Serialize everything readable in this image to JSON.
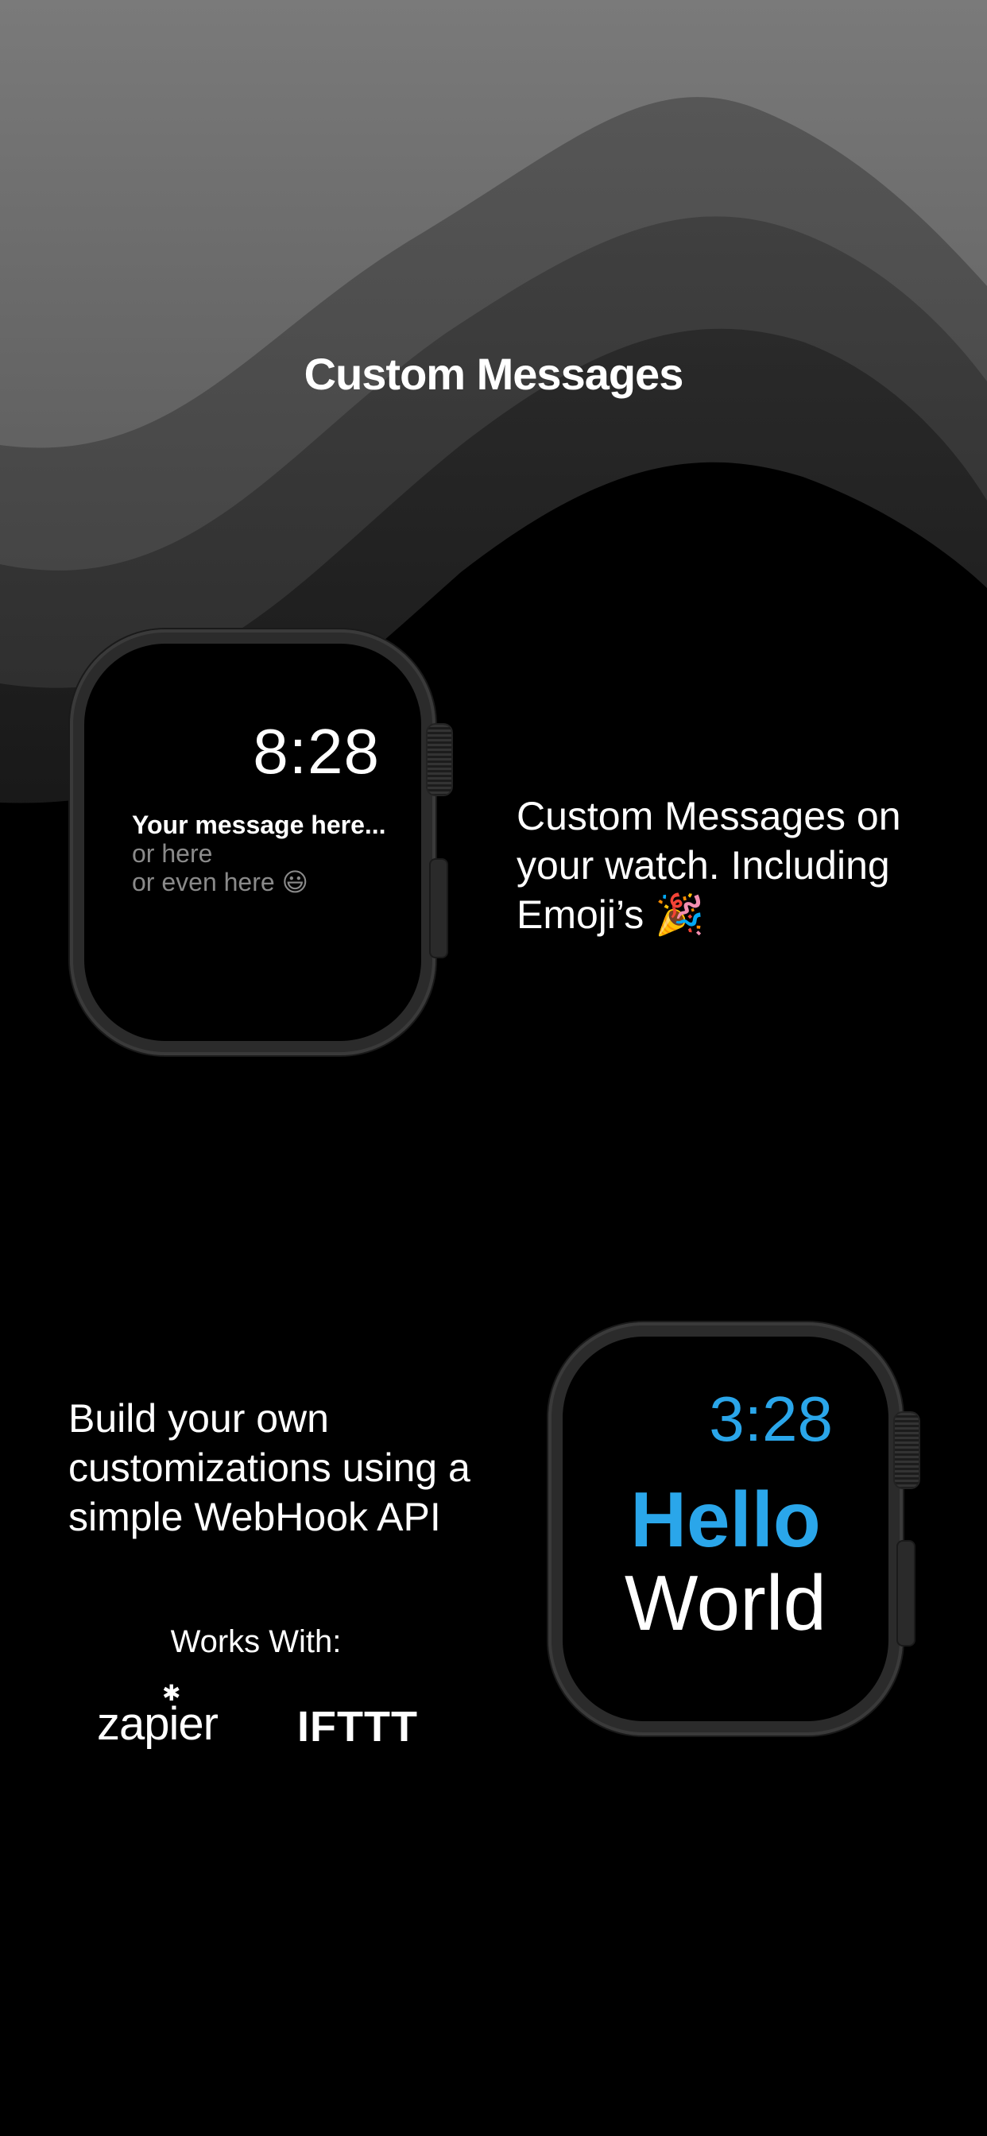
{
  "headline": "Custom Messages",
  "colors": {
    "accent_blue": "#2aa6ea",
    "background": "#000000",
    "wave_light": "#6a6a6a",
    "wave_dark": "#2a2a2a"
  },
  "watch1": {
    "time": "8:28",
    "lines": [
      "Your message here...",
      "or here",
      "or even here 😃"
    ]
  },
  "watch1_description": {
    "lines": [
      "Custom Messages on",
      "your watch. Including",
      "Emoji’s 🎉"
    ]
  },
  "webhook_description": {
    "lines": [
      "Build your own",
      "customizations using a",
      "simple WebHook API"
    ]
  },
  "works_with": {
    "label": "Works With:",
    "zapier": "zapier",
    "ifttt": "IFTTT"
  },
  "watch2": {
    "time": "3:28",
    "hello": "Hello",
    "world": "World"
  }
}
